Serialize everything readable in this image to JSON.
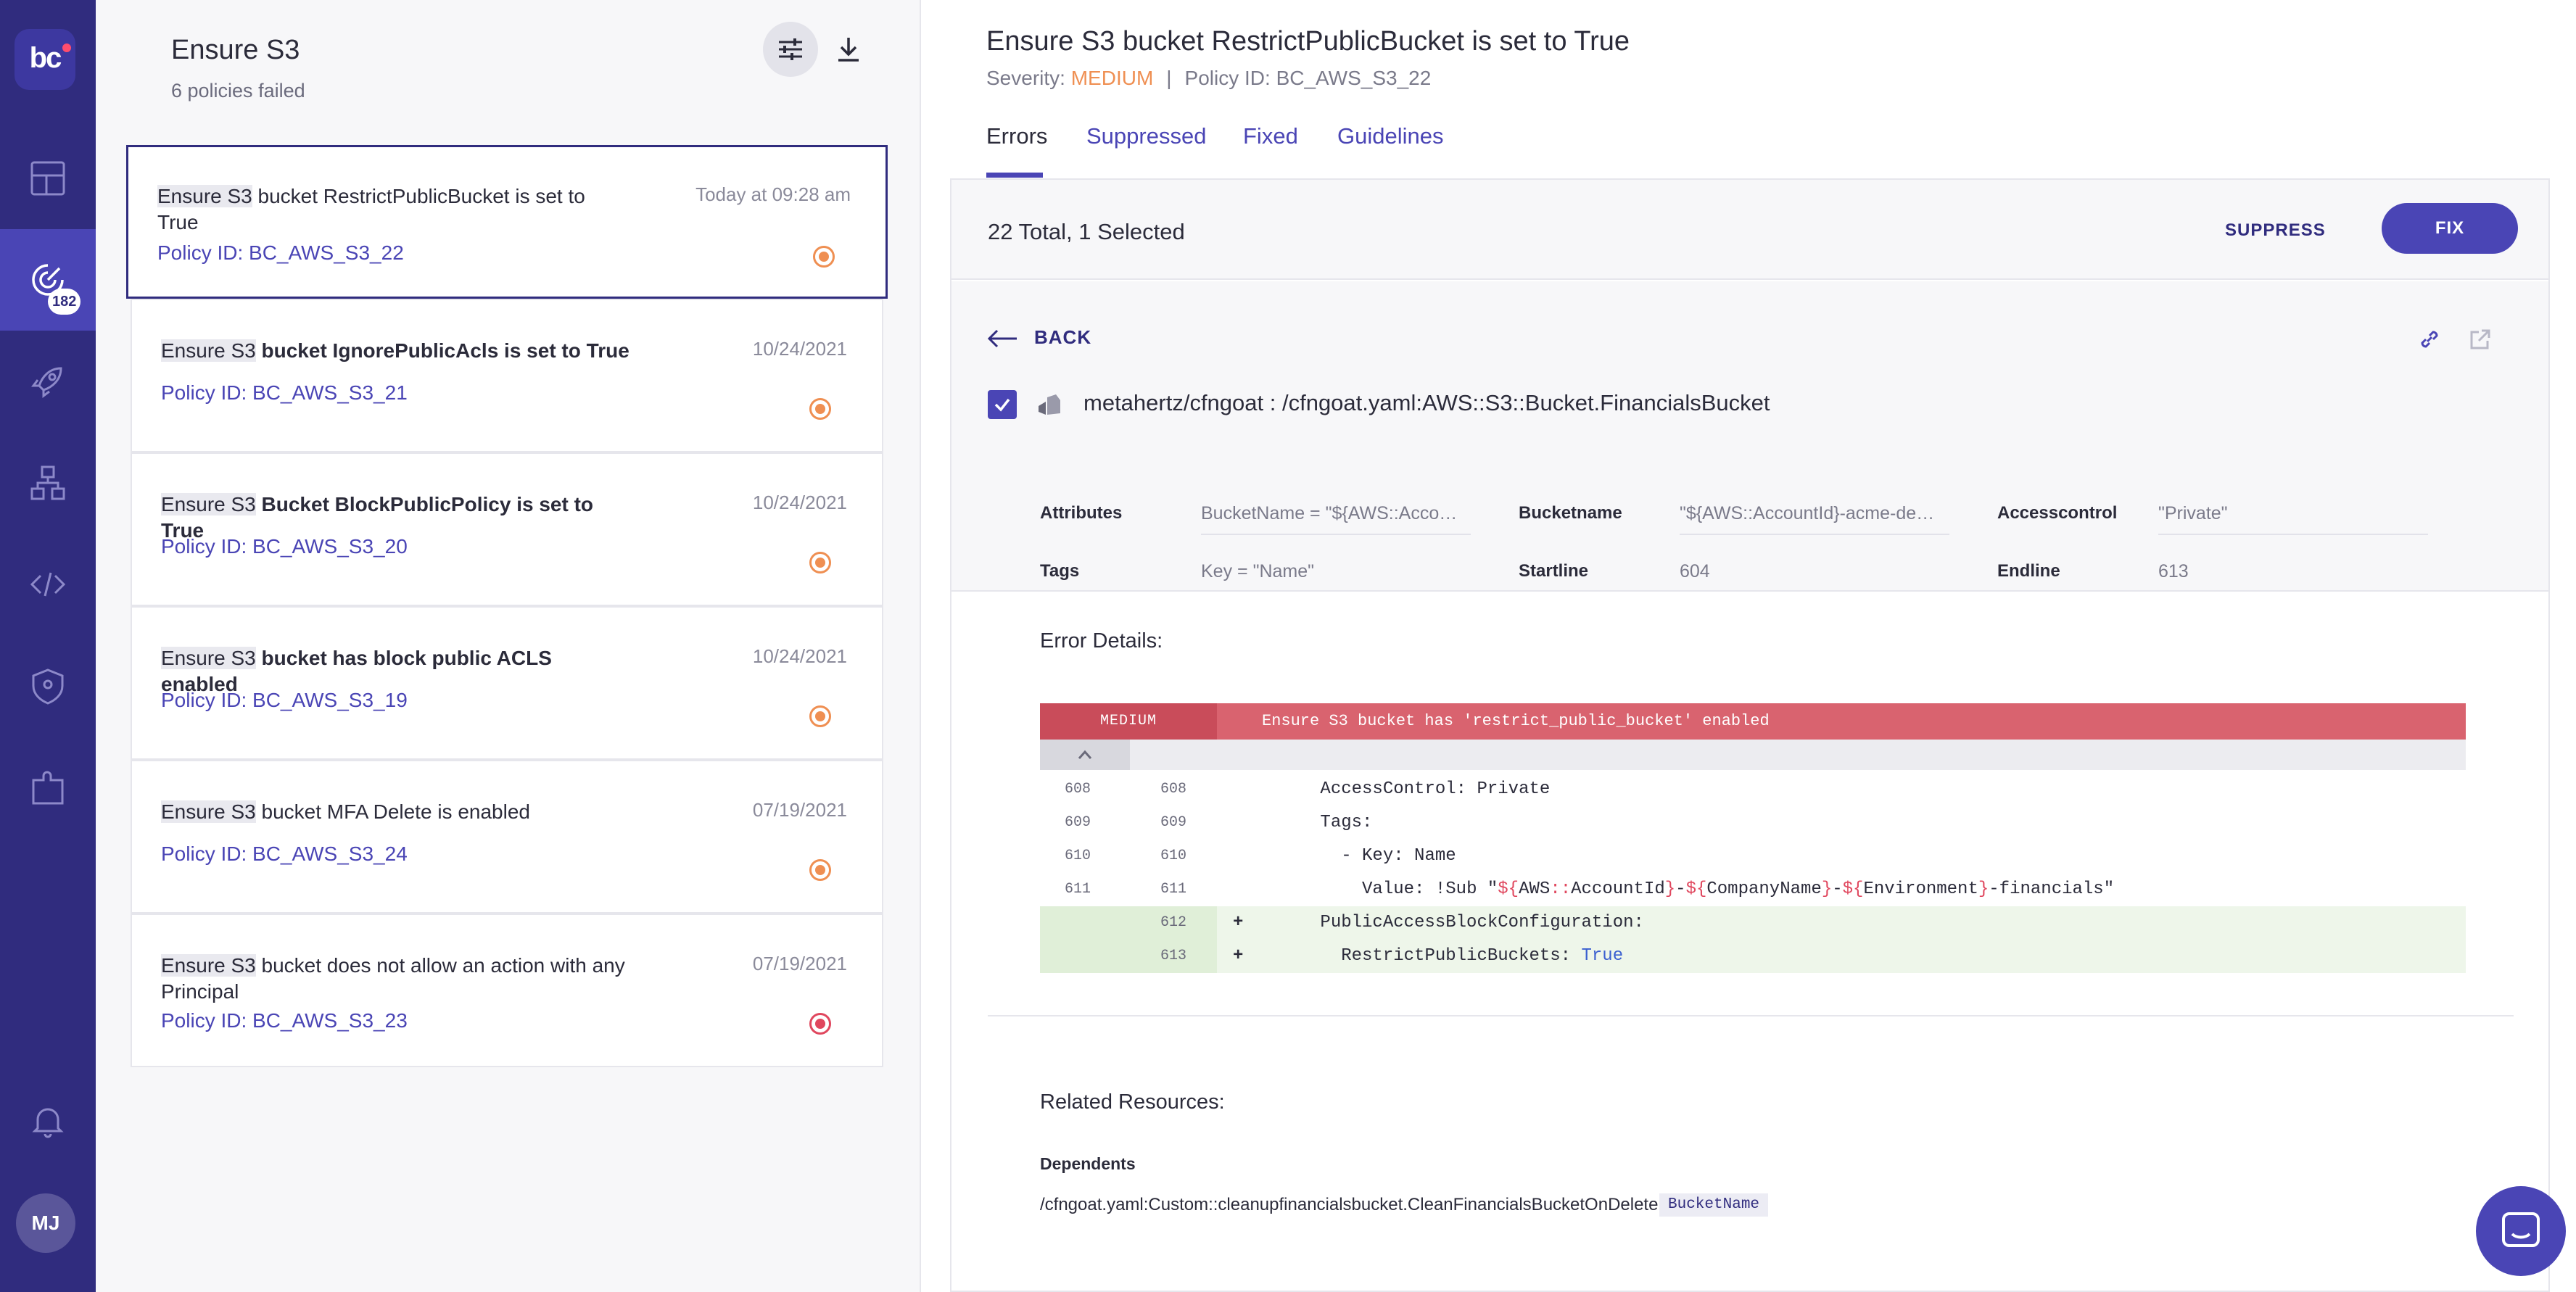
{
  "nav": {
    "logo_text": "bc",
    "items": [
      "dashboard-icon",
      "incidents-icon",
      "projects-icon",
      "resources-icon",
      "code-icon",
      "shield-icon",
      "integrations-icon"
    ],
    "badge": "182",
    "notification_icon": "bell-icon",
    "avatar": "MJ"
  },
  "list": {
    "title": "Ensure S3",
    "subtitle": "6 policies failed",
    "filter_icon": "sliders-icon",
    "download_icon": "download-icon",
    "cards": [
      {
        "hl": "Ensure S3",
        "rest": " bucket RestrictPublicBucket is set to True",
        "policy": "Policy ID: BC_AWS_S3_22",
        "date": "Today at 09:28 am",
        "severity": "medium"
      },
      {
        "hl": "Ensure S3",
        "rest": " bucket IgnorePublicAcls is set to True",
        "policy": "Policy ID: BC_AWS_S3_21",
        "date": "10/24/2021",
        "severity": "medium"
      },
      {
        "hl": "Ensure S3",
        "rest": " Bucket BlockPublicPolicy is set to True",
        "policy": "Policy ID: BC_AWS_S3_20",
        "date": "10/24/2021",
        "severity": "medium"
      },
      {
        "hl": "Ensure S3",
        "rest": " bucket has block public ACLS enabled",
        "policy": "Policy ID: BC_AWS_S3_19",
        "date": "10/24/2021",
        "severity": "medium"
      },
      {
        "hl": "Ensure S3",
        "rest": " bucket MFA Delete is enabled",
        "policy": "Policy ID: BC_AWS_S3_24",
        "date": "07/19/2021",
        "severity": "medium"
      },
      {
        "hl": "Ensure S3",
        "rest": " bucket does not allow an action with any Principal",
        "policy": "Policy ID: BC_AWS_S3_23",
        "date": "07/19/2021",
        "severity": "high"
      }
    ]
  },
  "detail": {
    "title": "Ensure S3 bucket RestrictPublicBucket is set to True",
    "severity_label": "Severity:",
    "severity_value": "MEDIUM",
    "separator": "|",
    "policy_id": "Policy ID: BC_AWS_S3_22",
    "tabs": [
      "Errors",
      "Suppressed",
      "Fixed",
      "Guidelines"
    ],
    "total": "22 Total, 1 Selected",
    "suppress_label": "SUPPRESS",
    "fix_label": "FIX",
    "back_label": "BACK",
    "resource": "metahertz/cfngoat : /cfngoat.yaml:AWS::S3::Bucket.FinancialsBucket",
    "attributes": [
      {
        "label": "Attributes",
        "value": "BucketName = \"${AWS::AccountId}-acme-dev-financials\""
      },
      {
        "label": "Bucketname",
        "value": "\"${AWS::AccountId}-acme-dev-financials\""
      },
      {
        "label": "Accesscontrol",
        "value": "\"Private\""
      },
      {
        "label": "Tags",
        "value": "Key = \"Name\""
      },
      {
        "label": "Startline",
        "value": "604"
      },
      {
        "label": "Endline",
        "value": "613"
      }
    ],
    "error_details_title": "Error Details:",
    "code": {
      "severity": "MEDIUM",
      "message": "Ensure S3 bucket has 'restrict_public_bucket' enabled",
      "rows": [
        {
          "old": "608",
          "new": "608",
          "sign": "",
          "indent": "      ",
          "key": "AccessControl:",
          "val": " Private"
        },
        {
          "old": "609",
          "new": "609",
          "sign": "",
          "indent": "      ",
          "key": "Tags:",
          "val": ""
        },
        {
          "old": "610",
          "new": "610",
          "sign": "",
          "indent": "        ",
          "key": "- Key:",
          "val": " Name"
        },
        {
          "old": "611",
          "new": "611",
          "sign": "",
          "indent": "          ",
          "key": "Value:",
          "val": " !Sub \"${AWS::AccountId}-${CompanyName}-${Environment}-financials\""
        },
        {
          "old": "",
          "new": "612",
          "sign": "+",
          "indent": "      ",
          "key": "PublicAccessBlockConfiguration:",
          "val": ""
        },
        {
          "old": "",
          "new": "613",
          "sign": "+",
          "indent": "        ",
          "key": "RestrictPublicBuckets:",
          "val": " True"
        }
      ]
    },
    "related_title": "Related Resources:",
    "dependents_label": "Dependents",
    "dependent_value": "/cfngoat.yaml:Custom::cleanupfinancialsbucket.CleanFinancialsBucketOnDelete",
    "dependent_tag": "BucketName"
  },
  "colors": {
    "nav_bg": "#302c7e",
    "accent": "#4a45b5",
    "medium": "#ef8f52",
    "high": "#e0475e",
    "code_header": "#d9636f",
    "added_row": "#eef6ea"
  }
}
